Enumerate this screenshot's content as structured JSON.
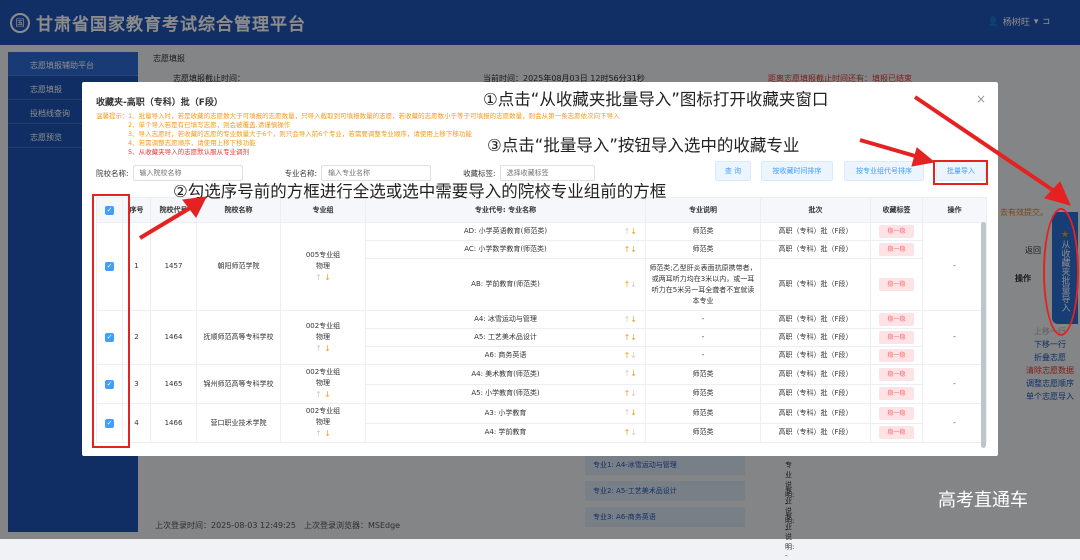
{
  "app": {
    "title": "甘肃省国家教育考试综合管理平台",
    "user": "杨树旺"
  },
  "sidebar": {
    "items": [
      {
        "label": "志愿填报辅助平台"
      },
      {
        "label": "志愿填报"
      },
      {
        "label": "投档线查询"
      },
      {
        "label": "志愿预览"
      }
    ]
  },
  "main": {
    "breadcrumb": "志愿填报",
    "deadline": "志愿填报截止时间：",
    "current_time": "当前时间：2025年08月03日 12时56分31秒",
    "countdown": "距离志愿填报截止时间还有：填报已结束",
    "submit_note": "去有效提交。",
    "back": "返回",
    "ops_header": "操作",
    "ops": [
      {
        "label": "上移一行",
        "color": "#aaa"
      },
      {
        "label": "下移一行",
        "color": "#1f56b8"
      },
      {
        "label": "折叠志愿",
        "color": "#1f56b8"
      },
      {
        "label": "清除志愿数据",
        "color": "#e53935"
      },
      {
        "label": "调整志愿顺序",
        "color": "#1f56b8"
      },
      {
        "label": "单个志愿导入",
        "color": "#1f56b8"
      }
    ],
    "bg_majors": [
      {
        "label": "专业1: A4-冰雪运动与管理",
        "note": "专业说明: -"
      },
      {
        "label": "专业2: A5-工艺美术品设计",
        "note": "专业说明: -"
      },
      {
        "label": "专业3: A6-商务英语",
        "note": "专业说明: -"
      }
    ],
    "last_login": "上次登录时间：2025-08-03 12:49:25　上次登录浏览器：MSEdge"
  },
  "side_tab": {
    "label": "从收藏夹批量导入",
    "icon": "star-icon"
  },
  "modal": {
    "title": "收藏夹-高职（专科）批（F段）",
    "tips_label": "温馨提示：",
    "tips": [
      "1、批量导入时，若是收藏的志愿数大于可填报的志愿数量，只导入截取到可填报数量的志愿，若收藏的志愿数小于等于可填报的志愿数量，则会从第一条志愿依次向下导入",
      "2、单个导入若是有已填写志愿，则会被覆盖,请谨慎操作",
      "3、导入志愿时，若收藏的志愿的专业数量大于6个，则只会导入前6个专业，若需要调整专业顺序，请使用上移下移功能",
      "4、若需调整志愿顺序，请使用上移下移功能",
      "5、从收藏夹导入的志愿默认服从专业调剂"
    ],
    "filters": {
      "school_label": "院校名称:",
      "school_placeholder": "输入院校名称",
      "major_label": "专业名称:",
      "major_placeholder": "输入专业名称",
      "tag_label": "收藏标签:",
      "tag_placeholder": "选择收藏标签"
    },
    "buttons": {
      "query": "查 询",
      "sort_time": "按收藏时间排序",
      "sort_code": "按专业组代号排序",
      "batch_import": "批量导入"
    },
    "columns": [
      "序号",
      "院校代号",
      "院校名称",
      "专业组",
      "专业代号: 专业名称",
      "专业说明",
      "批次",
      "收藏标签",
      "操作"
    ],
    "rows": [
      {
        "no": "1",
        "code": "1457",
        "school": "朝阳师范学院",
        "group": "005专业组",
        "subject": "物理",
        "checked": true,
        "majors": [
          {
            "name": "AD: 小学英语教育(师范类)",
            "desc": "师范类",
            "batch": "高职（专科）批（F段）",
            "tag": "稳一稳"
          },
          {
            "name": "AC: 小学数学教育(师范类)",
            "desc": "师范类",
            "batch": "高职（专科）批（F段）",
            "tag": "稳一稳"
          },
          {
            "name": "AB: 学前教育(师范类)",
            "desc": "师范类;乙型肝炎表面抗原携带者，或两耳听力均在3米以内，或一耳听力在5米另一耳全聋者不宜就读本专业",
            "batch": "高职（专科）批（F段）",
            "tag": "稳一稳"
          }
        ]
      },
      {
        "no": "2",
        "code": "1464",
        "school": "抚顺师范高等专科学校",
        "group": "002专业组",
        "subject": "物理",
        "checked": true,
        "majors": [
          {
            "name": "A4: 冰雪运动与管理",
            "desc": "-",
            "batch": "高职（专科）批（F段）",
            "tag": "稳一稳"
          },
          {
            "name": "A5: 工艺美术品设计",
            "desc": "-",
            "batch": "高职（专科）批（F段）",
            "tag": "稳一稳"
          },
          {
            "name": "A6: 商务英语",
            "desc": "-",
            "batch": "高职（专科）批（F段）",
            "tag": "稳一稳"
          }
        ]
      },
      {
        "no": "3",
        "code": "1465",
        "school": "锦州师范高等专科学校",
        "group": "002专业组",
        "subject": "物理",
        "checked": true,
        "majors": [
          {
            "name": "A4: 美术教育(师范类)",
            "desc": "师范类",
            "batch": "高职（专科）批（F段）",
            "tag": "稳一稳"
          },
          {
            "name": "A5: 小学教育(师范类)",
            "desc": "师范类",
            "batch": "高职（专科）批（F段）",
            "tag": "稳一稳"
          }
        ]
      },
      {
        "no": "4",
        "code": "1466",
        "school": "营口职业技术学院",
        "group": "002专业组",
        "subject": "物理",
        "checked": true,
        "majors": [
          {
            "name": "A3: 小学教育",
            "desc": "师范类",
            "batch": "高职（专科）批（F段）",
            "tag": "稳一稳"
          },
          {
            "name": "A4: 学前教育",
            "desc": "师范类",
            "batch": "高职（专科）批（F段）",
            "tag": "稳一稳"
          }
        ]
      }
    ],
    "op_value": "-"
  },
  "annotations": {
    "step1": "①点击“从收藏夹批量导入”图标打开收藏夹窗口",
    "step2": "②勾选序号前的方框进行全选或选中需要导入的院校专业组前的方框",
    "step3": "③点击“批量导入”按钮导入选中的收藏专业"
  },
  "watermark": "高考直通车",
  "colors": {
    "primary": "#1f56b8",
    "annotation": "#e52222",
    "warning": "#f39a1c"
  }
}
